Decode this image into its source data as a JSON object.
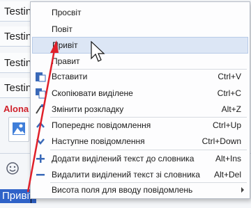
{
  "chat": {
    "messages": [
      "Testin",
      "Testin",
      "Testin",
      "Testin"
    ],
    "sender": "Alona",
    "input_selected_text": "Привіт"
  },
  "menu": {
    "suggestions": [
      "Просвіт",
      "Повіт",
      "Привіт",
      "Правит"
    ],
    "items": [
      {
        "label": "Вставити",
        "shortcut": "Ctrl+V",
        "icon": "paste-icon"
      },
      {
        "label": "Скопіювати виділене",
        "shortcut": "Ctrl+C",
        "icon": "copy-icon"
      },
      {
        "label": "Змінити розкладку",
        "shortcut": "Alt+Z",
        "icon": "keyboard-layout-icon"
      },
      {
        "label": "Попереднє повідомлення",
        "shortcut": "Ctrl+Up",
        "icon": "chevron-up-icon"
      },
      {
        "label": "Наступне повідомлення",
        "shortcut": "Ctrl+Down",
        "icon": "chevron-down-icon"
      },
      {
        "label": "Додати виділений текст до словника",
        "shortcut": "Alt+Ins",
        "icon": "plus-icon"
      },
      {
        "label": "Видалити виділений текст зі словника",
        "shortcut": "Alt+Del",
        "icon": "minus-icon"
      },
      {
        "label": "Висота поля для вводу повідомлень",
        "shortcut": "",
        "icon": "submenu-arrow-icon"
      }
    ]
  },
  "colors": {
    "highlight": "#dce6f5",
    "accent": "#2f62c8",
    "annotation": "#e0202a"
  }
}
